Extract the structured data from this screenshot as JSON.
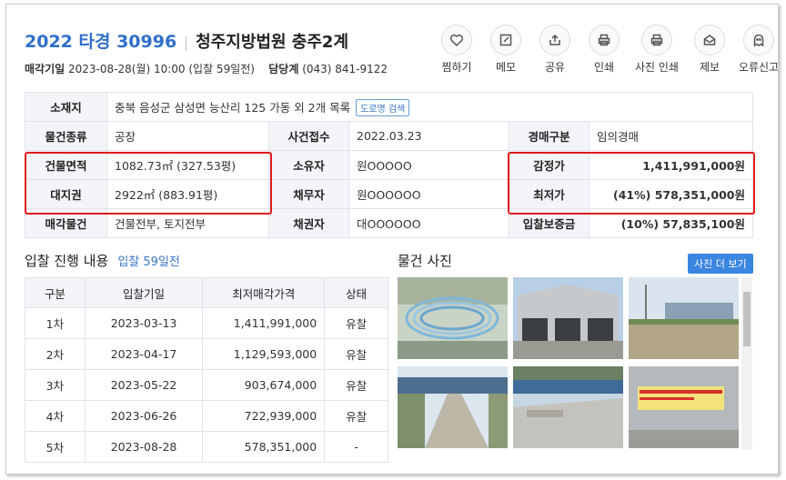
{
  "header": {
    "case_no": "2022 타경 30996",
    "court": "청주지방법원 충주2계"
  },
  "subheader": {
    "sale_label": "매각기일",
    "sale_value": "2023-08-28(월) 10:00 (입찰 59일전)",
    "staff_label": "담당계",
    "staff_value": "(043) 841-9122"
  },
  "actions": [
    {
      "label": "찜하기",
      "icon": "heart-icon"
    },
    {
      "label": "메모",
      "icon": "memo-icon"
    },
    {
      "label": "공유",
      "icon": "share-icon"
    },
    {
      "label": "인쇄",
      "icon": "print-icon"
    },
    {
      "label": "사진 인쇄",
      "icon": "print-photo-icon"
    },
    {
      "label": "제보",
      "icon": "report-icon"
    },
    {
      "label": "오류신고",
      "icon": "ghost-icon"
    }
  ],
  "info": {
    "address_label": "소재지",
    "address_value": "충북 음성군 삼성면 능산리 125 가동 외 2개 목록",
    "road_search": "도로명 검색",
    "type_label": "물건종류",
    "type_value": "공장",
    "received_label": "사건접수",
    "received_value": "2022.03.23",
    "kind_label": "경매구분",
    "kind_value": "임의경매",
    "building_label": "건물면적",
    "building_value": "1082.73㎡ (327.53평)",
    "owner_label": "소유자",
    "owner_value": "원OOOOO",
    "appraisal_label": "감정가",
    "appraisal_value": "1,411,991,000원",
    "land_label": "대지권",
    "land_value": "2922㎡ (883.91평)",
    "debtor_label": "채무자",
    "debtor_value": "원OOOOOO",
    "minimum_label": "최저가",
    "minimum_value": "(41%) 578,351,000원",
    "sale_items_label": "매각물건",
    "sale_items_value": "건물전부, 토지전부",
    "creditor_label": "채권자",
    "creditor_value": "대OOOOOO",
    "deposit_label": "입찰보증금",
    "deposit_value": "(10%) 57,835,100원"
  },
  "bid": {
    "title": "입찰 진행 내용",
    "subtitle": "입찰 59일전",
    "headers": [
      "구분",
      "입찰기일",
      "최저매각가격",
      "상태"
    ],
    "rows": [
      [
        "1차",
        "2023-03-13",
        "1,411,991,000",
        "유찰"
      ],
      [
        "2차",
        "2023-04-17",
        "1,129,593,000",
        "유찰"
      ],
      [
        "3차",
        "2023-05-22",
        "903,674,000",
        "유찰"
      ],
      [
        "4차",
        "2023-06-26",
        "722,939,000",
        "유찰"
      ],
      [
        "5차",
        "2023-08-28",
        "578,351,000",
        "-"
      ]
    ]
  },
  "photos": {
    "title": "물건 사진",
    "more_button": "사진 더 보기"
  },
  "colors": {
    "accent": "#2f6fca",
    "highlight_box": "#e01b1b",
    "label_bg": "#f3f5f9"
  }
}
